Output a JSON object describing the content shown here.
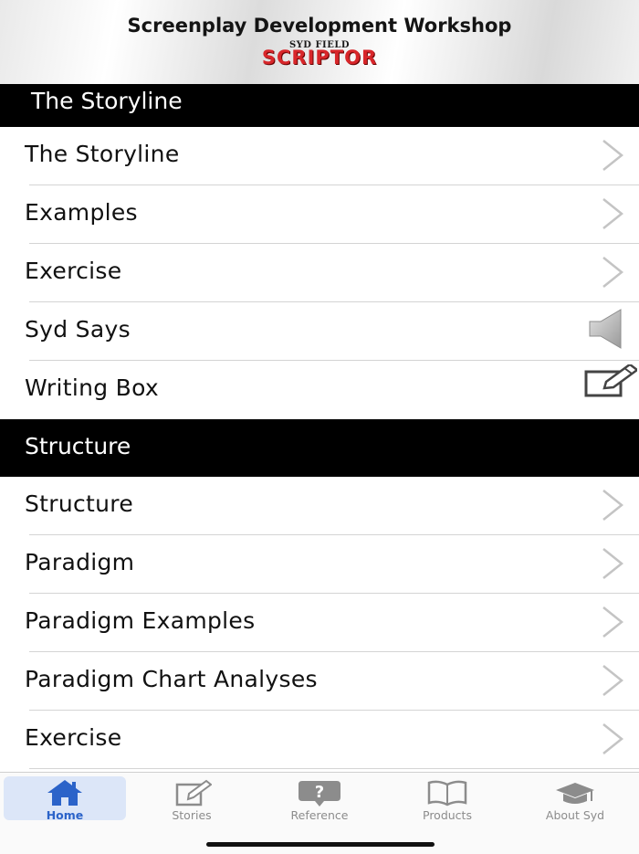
{
  "header": {
    "title": "Screenplay Development Workshop",
    "logo_small": "SYD FIELD",
    "logo_main": "SCRIPTOR"
  },
  "sections": [
    {
      "title": "The Storyline",
      "items": [
        {
          "label": "The Storyline",
          "icon": "chevron-right-icon"
        },
        {
          "label": "Examples",
          "icon": "chevron-right-icon"
        },
        {
          "label": "Exercise",
          "icon": "chevron-right-icon"
        },
        {
          "label": "Syd Says",
          "icon": "speaker-icon"
        },
        {
          "label": "Writing Box",
          "icon": "edit-icon"
        }
      ]
    },
    {
      "title": "Structure",
      "items": [
        {
          "label": "Structure",
          "icon": "chevron-right-icon"
        },
        {
          "label": "Paradigm",
          "icon": "chevron-right-icon"
        },
        {
          "label": "Paradigm Examples",
          "icon": "chevron-right-icon"
        },
        {
          "label": "Paradigm Chart Analyses",
          "icon": "chevron-right-icon"
        },
        {
          "label": "Exercise",
          "icon": "chevron-right-icon"
        }
      ]
    }
  ],
  "tabbar": {
    "selected": "Home",
    "tabs": [
      {
        "label": "Home",
        "icon": "home-icon"
      },
      {
        "label": "Stories",
        "icon": "pencil-square-icon"
      },
      {
        "label": "Reference",
        "icon": "question-bubble-icon"
      },
      {
        "label": "Products",
        "icon": "open-book-icon"
      },
      {
        "label": "About Syd",
        "icon": "graduation-cap-icon"
      }
    ]
  },
  "colors": {
    "accent": "#2b63c9",
    "section_header_bg": "#000000",
    "logo_red": "#d8262a"
  }
}
